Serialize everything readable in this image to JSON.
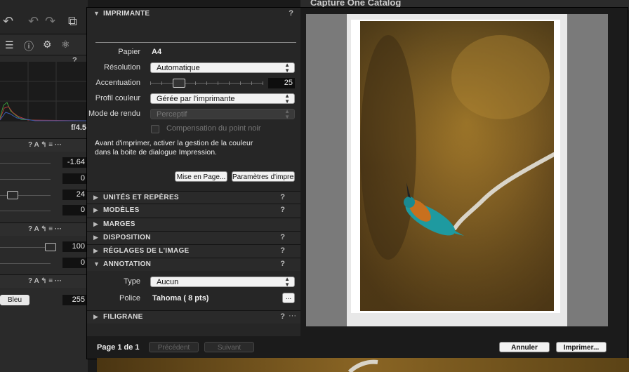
{
  "app": {
    "window_title": "Capture One Catalog"
  },
  "left_panel": {
    "histogram_readout": "f/4.5",
    "exposure_values": [
      "-1.64",
      "0",
      "24",
      "0"
    ],
    "level_values": [
      "100",
      "0"
    ],
    "color_channel_button": "Bleu",
    "color_value": "255"
  },
  "dialog": {
    "printer_section": {
      "title": "IMPRIMANTE",
      "help": "?",
      "paper_label": "Papier",
      "paper_value": "A4",
      "resolution_label": "Résolution",
      "resolution_value": "Automatique",
      "sharpening_label": "Accentuation",
      "sharpening_value": "25",
      "sharpening_level": 0.25,
      "profile_label": "Profil couleur",
      "profile_value": "Gérée par l'imprimante",
      "render_label": "Mode de rendu",
      "render_value": "Perceptif",
      "blackpoint_label": "Compensation du point noir",
      "notice": "Avant d'imprimer, activer la gestion de la couleur dans la boite de dialogue Impression.",
      "page_setup_button": "Mise en Page...",
      "print_settings_button": "Paramètres d'impression..."
    },
    "sections": [
      {
        "title": "UNITÉS ET REPÈRES",
        "help": "?"
      },
      {
        "title": "MODÈLES",
        "help": "?"
      },
      {
        "title": "MARGES",
        "help": ""
      },
      {
        "title": "DISPOSITION",
        "help": "?"
      },
      {
        "title": "RÉGLAGES DE L'IMAGE",
        "help": "?"
      }
    ],
    "annotation": {
      "title": "ANNOTATION",
      "help": "?",
      "type_label": "Type",
      "type_value": "Aucun",
      "font_label": "Police",
      "font_value": "Tahoma ( 8 pts)",
      "more_button": "..."
    },
    "watermark": {
      "title": "FILIGRANE",
      "help": "?",
      "more": "···"
    },
    "footer": {
      "page_indicator": "Page 1 de 1",
      "prev_button": "Précédent",
      "next_button": "Suivant",
      "cancel_button": "Annuler",
      "print_button": "Imprimer..."
    }
  },
  "colors": {
    "accent": "#f2f2f2",
    "panel": "#262626",
    "dialog": "#1b1b1b"
  }
}
